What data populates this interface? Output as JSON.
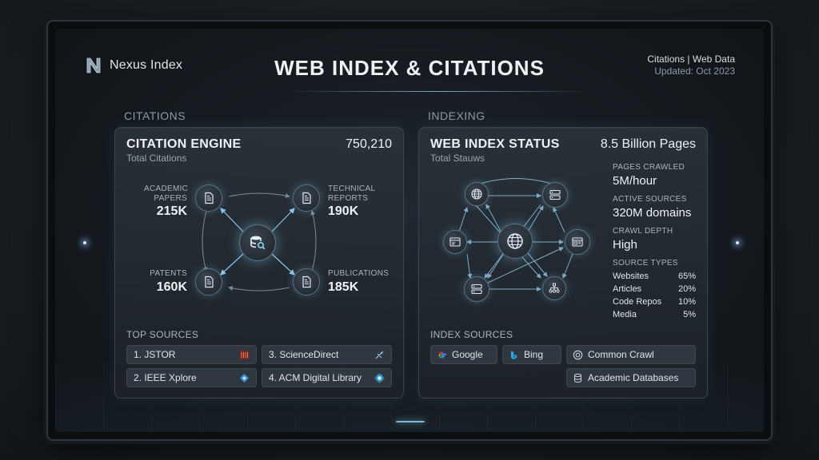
{
  "header": {
    "logo_text": "Nexus Index",
    "title": "WEB INDEX & CITATIONS",
    "meta_line1": "Citations | Web Data",
    "meta_line2": "Updated: Oct 2023"
  },
  "sections": {
    "left_label": "CITATIONS",
    "right_label": "INDEXING"
  },
  "citation_engine": {
    "title": "CITATION ENGINE",
    "subtitle": "Total Citations",
    "total": "750,210",
    "categories": [
      {
        "label_1": "ACADEMIC",
        "label_2": "PAPERS",
        "value": "215K",
        "icon": "document-icon"
      },
      {
        "label_1": "TECHNICAL",
        "label_2": "REPORTS",
        "value": "190K",
        "icon": "document-icon"
      },
      {
        "label_1": "PATENTS",
        "label_2": "",
        "value": "160K",
        "icon": "document-icon"
      },
      {
        "label_1": "PUBLICATIONS",
        "label_2": "",
        "value": "185K",
        "icon": "document-icon"
      }
    ],
    "center_icon": "database-search-icon",
    "top_sources_label": "TOP SOURCES",
    "top_sources": [
      {
        "label": "1. JSTOR",
        "icon": "jstor-icon"
      },
      {
        "label": "3. ScienceDirect",
        "icon": "sciencedirect-icon"
      },
      {
        "label": "2. IEEE Xplore",
        "icon": "ieee-icon"
      },
      {
        "label": "4. ACM Digital Library",
        "icon": "acm-icon"
      }
    ]
  },
  "web_index": {
    "title": "WEB INDEX STATUS",
    "subtitle": "Total Stauws",
    "total": "8.5 Billion Pages",
    "stats": [
      {
        "label": "PAGES CRAWLED",
        "value": "5M/hour"
      },
      {
        "label": "ACTIVE SOURCES",
        "value": "320M domains"
      },
      {
        "label": "CRAWL DEPTH",
        "value": "High"
      }
    ],
    "source_types_label": "SOURCE TYPES",
    "source_types": [
      {
        "name": "Websites",
        "pct": "65%"
      },
      {
        "name": "Articles",
        "pct": "20%"
      },
      {
        "name": "Code Repos",
        "pct": "10%"
      },
      {
        "name": "Media",
        "pct": "5%"
      }
    ],
    "index_sources_label": "INDEX SOURCES",
    "index_sources": [
      {
        "label": "Google",
        "icon": "google-icon"
      },
      {
        "label": "Bing",
        "icon": "bing-icon"
      },
      {
        "label": "Common Crawl",
        "icon": "common-crawl-icon"
      },
      {
        "label": "Academic Databases",
        "icon": "database-icon"
      }
    ]
  },
  "colors": {
    "accent": "#7ab8dc",
    "panel_border": "#3b444c",
    "background": "#14191e"
  }
}
